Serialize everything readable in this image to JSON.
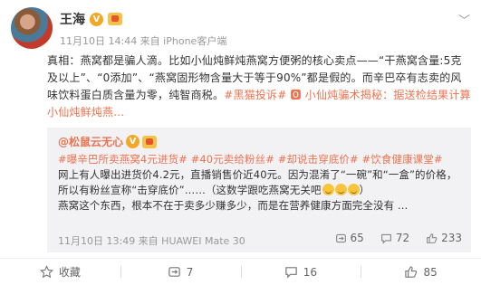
{
  "post": {
    "author": "王海",
    "verified_badge": "V",
    "meta": "11月10日 14:44 来自 iPhone客户端",
    "text": {
      "p1": "真相：燕窝都是骗人滴。比如小仙炖鲜炖燕窝方便粥的核心卖点——“干燕窝含量:5克及以上”、“0添加”、“燕窝固形物含量大于等于90%”都是假的。而辛巴卒有志卖的风味饮料蛋白质含量为零，纯智商税。",
      "tag": "#黑猫投诉#",
      "link": "🅾 小仙炖骗术揭秘：据送检结果计算小仙炖鲜炖燕..."
    }
  },
  "repost": {
    "author": "@松鼠云无心",
    "verified_badge": "V",
    "tags": "#曝辛巴所卖燕窝4元进货# #40元卖给粉丝# #却说击穿底价# #饮食健康课堂#",
    "text_a": "网上有人曝出进货价4.2元，直播销售价近40元。因为混淆了“一碗”和“一盒”的价格，所以有粉丝宣称“击穿底价”……（这数学跟吃燕窝无关吧",
    "text_b": "）",
    "text_c": "燕窝这个东西，根本不在于卖多少赚多少，而是在营养健康方面完全没有 ...",
    "meta": "11月10日 13:49 来自 HUAWEI Mate 30",
    "stats": {
      "reposts": "65",
      "comments": "72",
      "likes": "233"
    }
  },
  "actions": {
    "repost_label": "收藏",
    "forward_count": "7",
    "comment_count": "16",
    "like_count": "85"
  },
  "icons": {
    "avatar": "avatar",
    "chevron": "chevron-down-icon",
    "repost": "repost-icon",
    "comment": "comment-icon",
    "like": "thumbs-up-icon",
    "favorite": "star-icon"
  },
  "colors": {
    "accent": "#eb7350",
    "badge": "#f5a623",
    "repost_bg": "#f2f2f5"
  }
}
